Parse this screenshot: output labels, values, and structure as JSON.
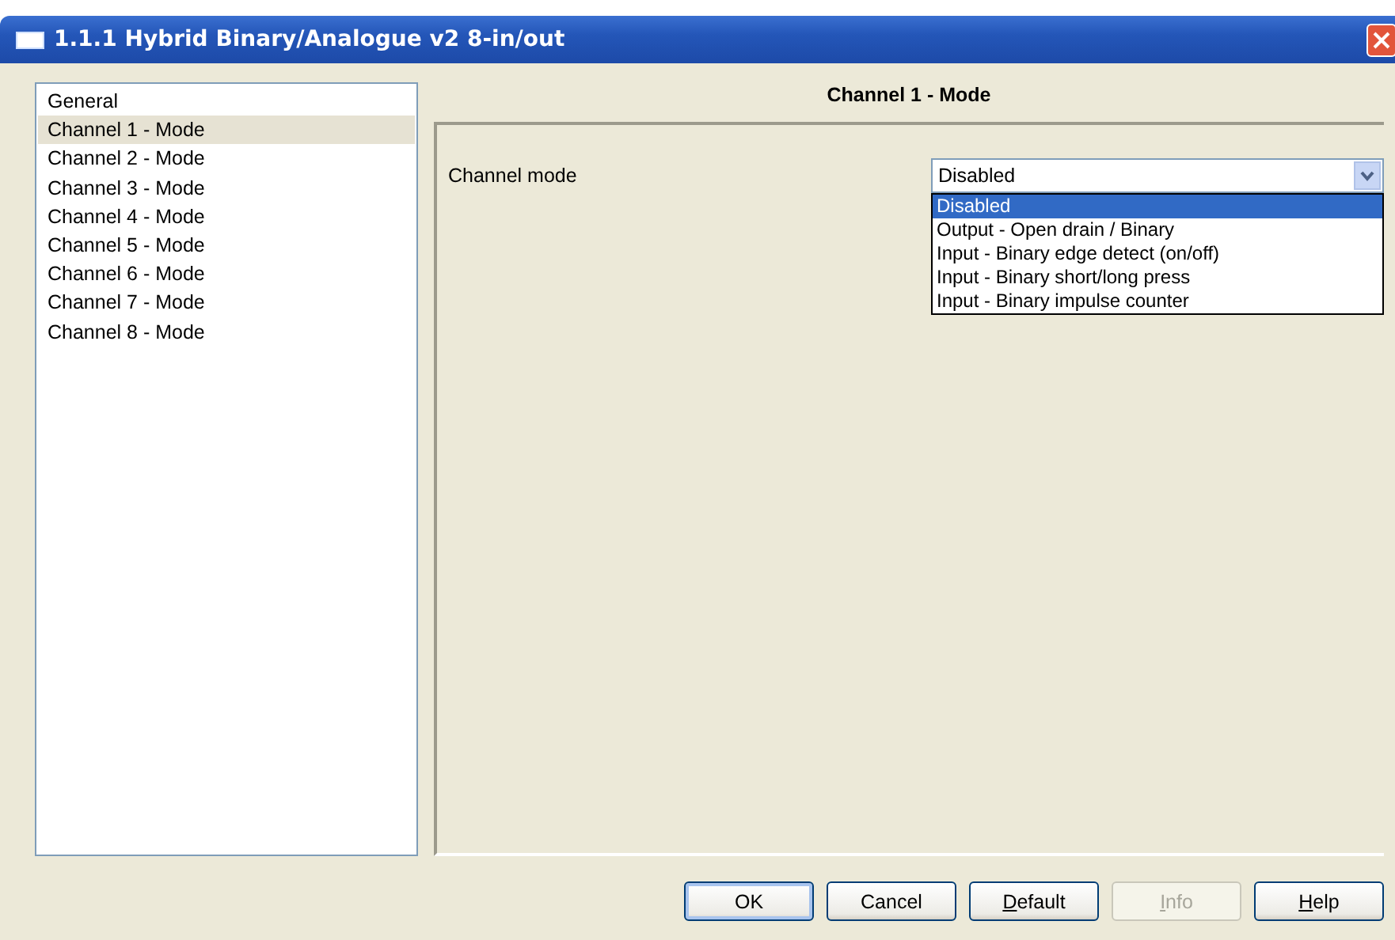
{
  "window": {
    "title": "1.1.1 Hybrid Binary/Analogue v2 8-in/out"
  },
  "sidebar": {
    "items": [
      {
        "label": "General",
        "selected": false
      },
      {
        "label": "Channel 1 - Mode",
        "selected": true
      },
      {
        "label": "Channel 2 - Mode",
        "selected": false
      },
      {
        "label": "Channel 3 - Mode",
        "selected": false
      },
      {
        "label": "Channel 4 - Mode",
        "selected": false
      },
      {
        "label": "Channel 5 - Mode",
        "selected": false
      },
      {
        "label": "Channel 6 - Mode",
        "selected": false
      },
      {
        "label": "Channel 7 - Mode",
        "selected": false
      },
      {
        "label": "Channel 8 - Mode",
        "selected": false
      }
    ]
  },
  "panel": {
    "title": "Channel 1 - Mode",
    "fields": [
      {
        "label": "Channel mode",
        "value": "Disabled",
        "expanded": true,
        "options": [
          {
            "label": "Disabled",
            "selected": true
          },
          {
            "label": "Output - Open drain / Binary",
            "selected": false
          },
          {
            "label": "Input - Binary edge detect (on/off)",
            "selected": false
          },
          {
            "label": "Input - Binary short/long press",
            "selected": false
          },
          {
            "label": "Input - Binary impulse counter",
            "selected": false
          }
        ]
      }
    ]
  },
  "buttons": [
    {
      "label": "OK",
      "default": true,
      "disabled": false,
      "mnemonic": false
    },
    {
      "label": "Cancel",
      "default": false,
      "disabled": false,
      "mnemonic": false
    },
    {
      "label": "Default",
      "default": false,
      "disabled": false,
      "mnemonic": true
    },
    {
      "label": "Info",
      "default": false,
      "disabled": true,
      "mnemonic": true
    },
    {
      "label": "Help",
      "default": false,
      "disabled": false,
      "mnemonic": true
    }
  ]
}
